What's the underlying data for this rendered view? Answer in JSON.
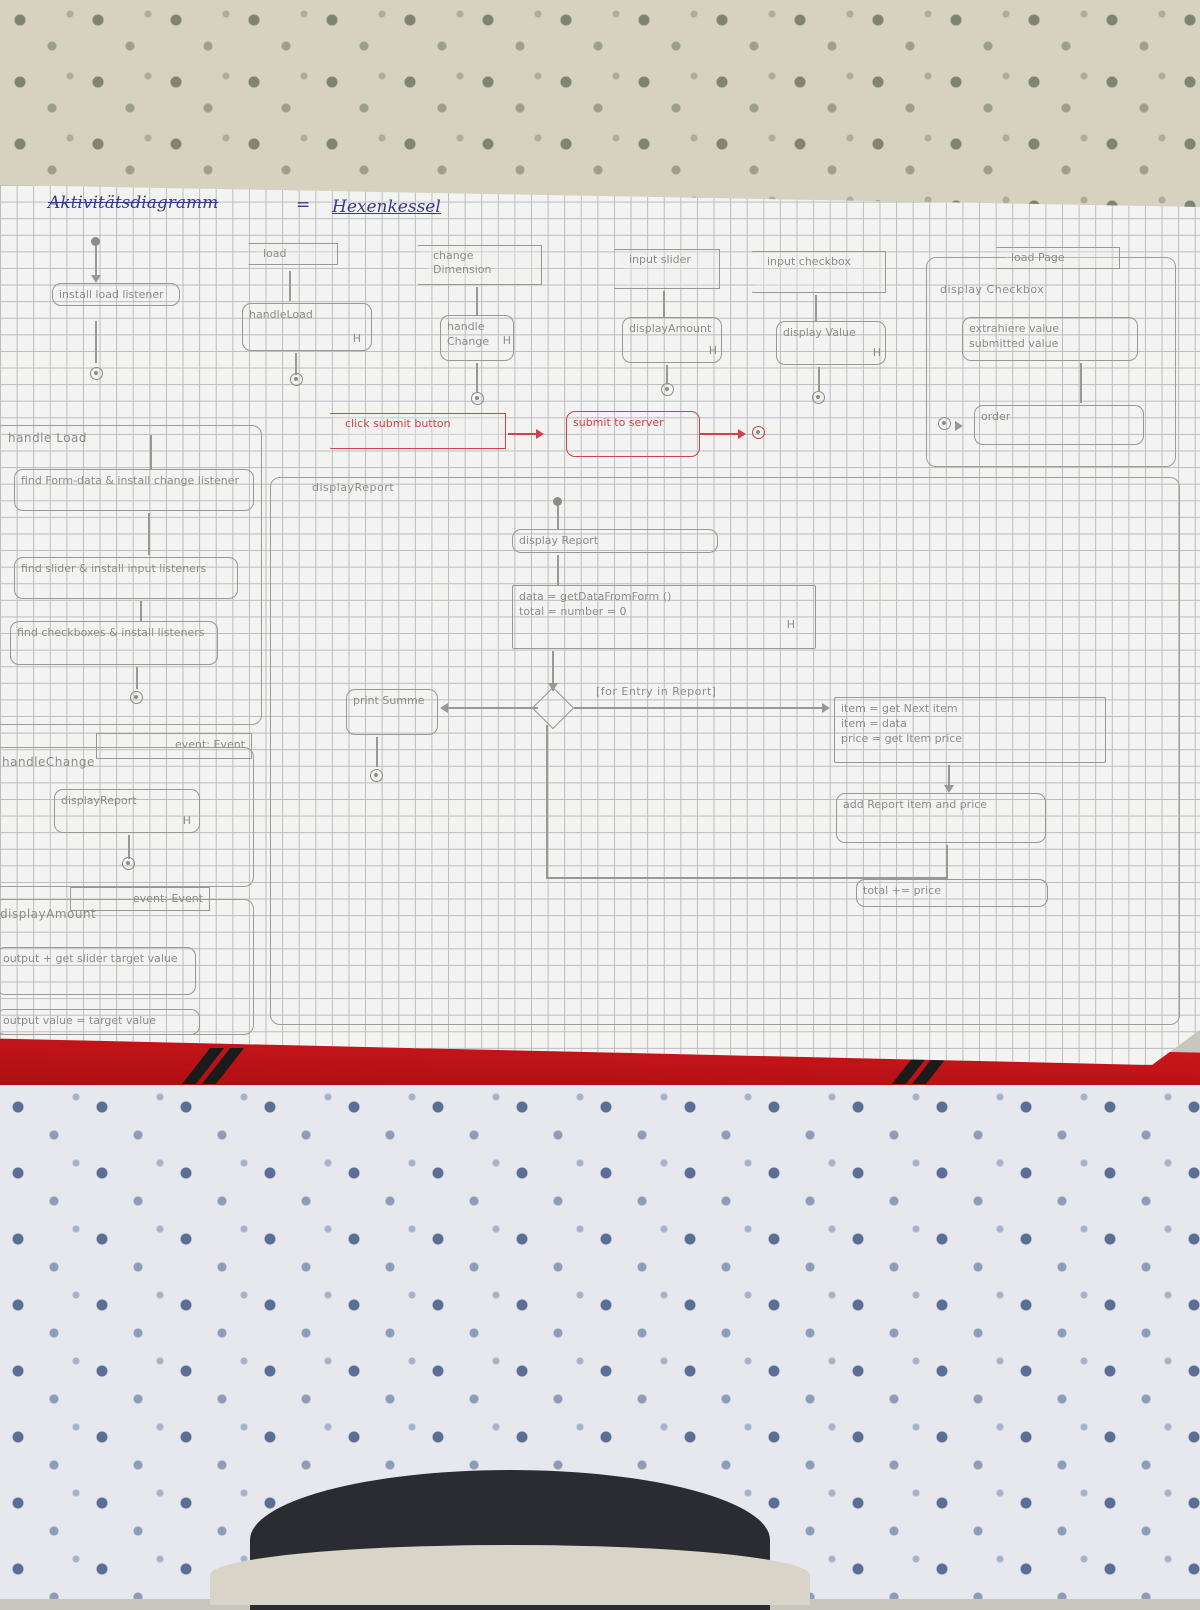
{
  "title": {
    "left": "Aktivitätsdiagramm",
    "sep": "=",
    "right": "Hexenkessel"
  },
  "top_row": {
    "col1": {
      "action": "install load listener"
    },
    "col2": {
      "signal": "load",
      "action": "handleLoad",
      "mark": "H"
    },
    "col3": {
      "signal": "change Dimension",
      "action": "handle Change",
      "mark": "H"
    },
    "col4": {
      "signal": "input slider",
      "action": "displayAmount",
      "mark": "H"
    },
    "col5": {
      "signal": "input checkbox",
      "action": "display Value",
      "mark": "H"
    },
    "col6": {
      "signal": "load Page",
      "accept": "display Checkbox",
      "action1": "extrahiere value",
      "action2": "submitted value",
      "final": "order"
    }
  },
  "red_flow": {
    "signal": "click submit button",
    "action": "submit to server"
  },
  "left_panel": {
    "handle_load": {
      "label": "handle Load",
      "a1": "find Form-data & install change listener",
      "a2": "find slider & install input listeners",
      "a3": "find checkboxes & install listeners"
    },
    "handle_change": {
      "label": "handleChange",
      "event": "event: Event",
      "action": "displayReport",
      "mark": "H"
    },
    "display_amount": {
      "label": "displayAmount",
      "event": "event: Event",
      "a1": "output + get slider target value",
      "a2": "output value = target value"
    }
  },
  "main_panel": {
    "label": "displayReport",
    "accept": "display Report",
    "a1": "data = getDataFromForm ()",
    "a2": "total = number = 0",
    "a2_mark": "H",
    "guard": "[for Entry in Report]",
    "print": "print Summe",
    "item": "item = get Next item",
    "item2": "item = data",
    "price": "price = get Item price",
    "add": "add Report item and price",
    "total": "total += price"
  }
}
